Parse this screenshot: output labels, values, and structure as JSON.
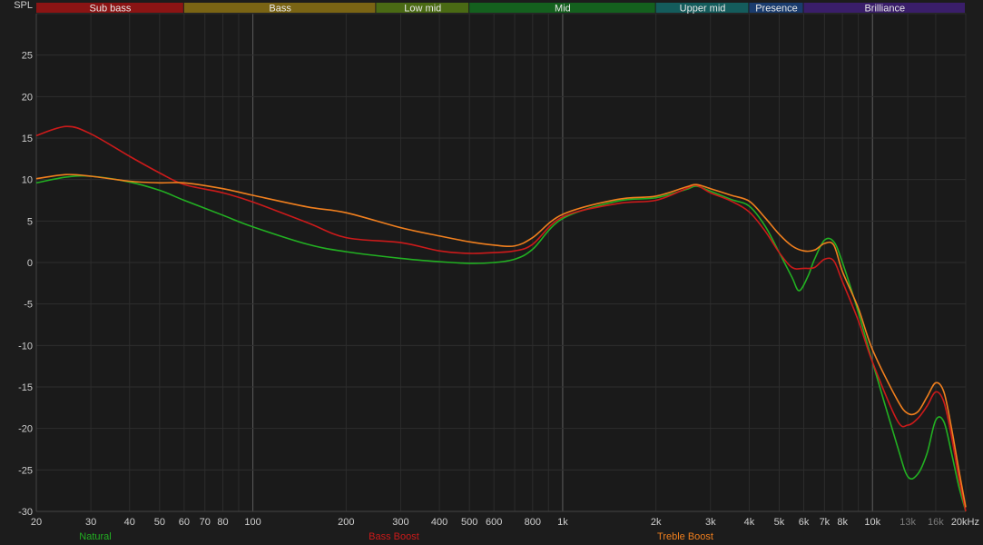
{
  "chart_data": {
    "type": "line",
    "ylabel": "SPL",
    "x_unit": "kHz",
    "x_scale": "log",
    "xlim": [
      20,
      20000
    ],
    "ylim": [
      -30,
      30
    ],
    "y_ticks": [
      25,
      20,
      15,
      10,
      5,
      0,
      -5,
      -10,
      -15,
      -20,
      -25,
      -30
    ],
    "x_ticks": [
      {
        "value": 20,
        "label": "20"
      },
      {
        "value": 30,
        "label": "30"
      },
      {
        "value": 40,
        "label": "40"
      },
      {
        "value": 50,
        "label": "50"
      },
      {
        "value": 60,
        "label": "60"
      },
      {
        "value": 70,
        "label": "70"
      },
      {
        "value": 80,
        "label": "80"
      },
      {
        "value": 100,
        "label": "100"
      },
      {
        "value": 200,
        "label": "200"
      },
      {
        "value": 300,
        "label": "300"
      },
      {
        "value": 400,
        "label": "400"
      },
      {
        "value": 500,
        "label": "500"
      },
      {
        "value": 600,
        "label": "600"
      },
      {
        "value": 800,
        "label": "800"
      },
      {
        "value": 1000,
        "label": "1k"
      },
      {
        "value": 2000,
        "label": "2k"
      },
      {
        "value": 3000,
        "label": "3k"
      },
      {
        "value": 4000,
        "label": "4k"
      },
      {
        "value": 5000,
        "label": "5k"
      },
      {
        "value": 6000,
        "label": "6k"
      },
      {
        "value": 7000,
        "label": "7k"
      },
      {
        "value": 8000,
        "label": "8k"
      },
      {
        "value": 10000,
        "label": "10k"
      },
      {
        "value": 13000,
        "label": "13k",
        "dim": true
      },
      {
        "value": 16000,
        "label": "16k",
        "dim": true
      },
      {
        "value": 20000,
        "label": "20kHz"
      }
    ],
    "major_x_lines": [
      100,
      1000,
      10000
    ],
    "bands": [
      {
        "name": "Sub bass",
        "from": 20,
        "to": 60,
        "color": "#8b1414"
      },
      {
        "name": "Bass",
        "from": 60,
        "to": 250,
        "color": "#7a6414"
      },
      {
        "name": "Low mid",
        "from": 250,
        "to": 500,
        "color": "#4a6a14"
      },
      {
        "name": "Mid",
        "from": 500,
        "to": 2000,
        "color": "#14601e"
      },
      {
        "name": "Upper mid",
        "from": 2000,
        "to": 4000,
        "color": "#145c5c"
      },
      {
        "name": "Presence",
        "from": 4000,
        "to": 6000,
        "color": "#1a3c6e"
      },
      {
        "name": "Brilliance",
        "from": 6000,
        "to": 20000,
        "color": "#3a1e6a"
      }
    ],
    "series": [
      {
        "name": "Natural",
        "color": "#22b022",
        "x": [
          20,
          25,
          30,
          40,
          50,
          60,
          80,
          100,
          150,
          200,
          300,
          400,
          500,
          600,
          700,
          800,
          1000,
          1500,
          2000,
          2500,
          2700,
          3000,
          3500,
          4000,
          4500,
          5000,
          5500,
          5800,
          6200,
          6500,
          7000,
          7500,
          8000,
          9000,
          10000,
          12000,
          13000,
          14000,
          15000,
          16000,
          17000,
          18000,
          19000,
          20000
        ],
        "y": [
          9.6,
          10.3,
          10.4,
          9.7,
          8.7,
          7.5,
          5.7,
          4.3,
          2.2,
          1.3,
          0.5,
          0.1,
          -0.1,
          0,
          0.4,
          1.6,
          5.3,
          7.4,
          7.8,
          8.8,
          9.2,
          8.6,
          7.6,
          6.8,
          4.4,
          1.2,
          -1.8,
          -3.4,
          -1.6,
          0.4,
          2.7,
          2.5,
          0,
          -6,
          -12,
          -22,
          -25.8,
          -25.5,
          -23,
          -19,
          -19.2,
          -23,
          -27,
          -30
        ]
      },
      {
        "name": "Bass Boost",
        "color": "#cc1a1a",
        "x": [
          20,
          25,
          30,
          40,
          50,
          60,
          80,
          100,
          150,
          200,
          300,
          400,
          500,
          600,
          700,
          800,
          1000,
          1500,
          2000,
          2500,
          2700,
          3000,
          3500,
          4000,
          4500,
          5000,
          5500,
          6000,
          6500,
          7000,
          7500,
          8000,
          9000,
          10000,
          12000,
          13000,
          14000,
          15000,
          16000,
          17000,
          18000,
          19000,
          20000
        ],
        "y": [
          15.3,
          16.4,
          15.5,
          12.8,
          10.8,
          9.4,
          8.4,
          7.3,
          4.8,
          3.0,
          2.4,
          1.4,
          1.1,
          1.2,
          1.4,
          2.2,
          5.5,
          7.1,
          7.5,
          8.9,
          9.3,
          8.4,
          7.4,
          6.1,
          3.8,
          1.2,
          -0.6,
          -0.7,
          -0.6,
          0.4,
          0.2,
          -2.3,
          -7,
          -12,
          -19,
          -19.6,
          -18.8,
          -17.3,
          -15.6,
          -16.8,
          -21,
          -26,
          -30
        ]
      },
      {
        "name": "Treble Boost",
        "color": "#f07f1e",
        "x": [
          20,
          25,
          30,
          40,
          50,
          60,
          80,
          100,
          150,
          200,
          300,
          400,
          500,
          600,
          700,
          800,
          1000,
          1500,
          2000,
          2500,
          2700,
          3000,
          3500,
          4000,
          4500,
          5000,
          5500,
          6000,
          6500,
          7000,
          7500,
          8000,
          9000,
          10000,
          12000,
          13000,
          14000,
          15000,
          16000,
          17000,
          18000,
          19000,
          20000
        ],
        "y": [
          10.1,
          10.6,
          10.4,
          9.8,
          9.6,
          9.6,
          8.9,
          8.1,
          6.7,
          6.0,
          4.2,
          3.2,
          2.5,
          2.1,
          2.0,
          3.0,
          5.8,
          7.6,
          8.0,
          9.1,
          9.4,
          8.9,
          8.1,
          7.4,
          5.4,
          3.4,
          2.0,
          1.4,
          1.5,
          2.3,
          2.1,
          -1.1,
          -5.5,
          -10.5,
          -16.5,
          -18.2,
          -18.0,
          -16.2,
          -14.5,
          -15.6,
          -20,
          -25,
          -29.5
        ]
      }
    ]
  }
}
